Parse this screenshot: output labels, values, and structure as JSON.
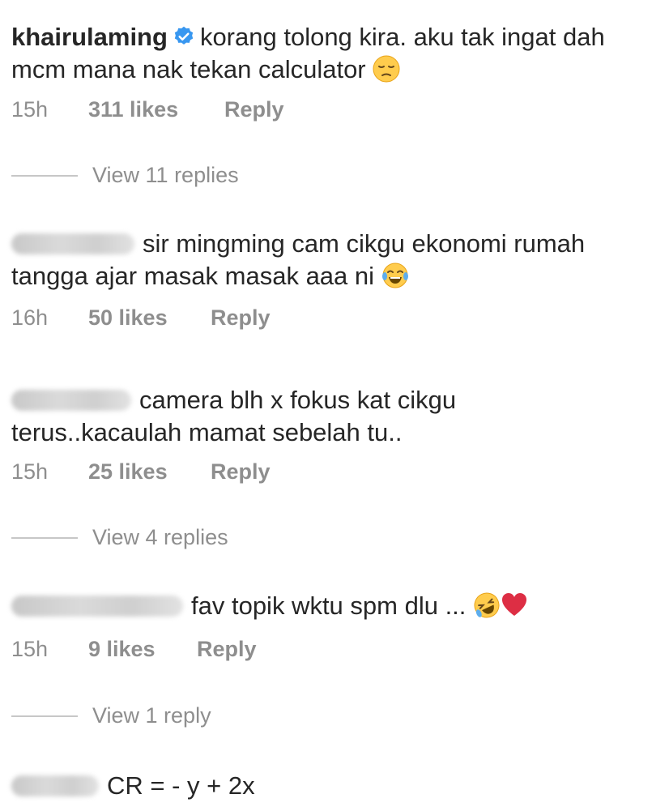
{
  "comments": [
    {
      "username": "khairulaming",
      "verified": true,
      "text_line1": "korang tolong kira. aku tak ingat dah",
      "text_line2": "mcm mana nak tekan calculator",
      "emoji": "pensive-face-icon",
      "time": "15h",
      "likes": "311 likes",
      "reply": "Reply",
      "view_replies": "View 11 replies"
    },
    {
      "username": "",
      "text_line1": "sir mingming cam cikgu ekonomi rumah",
      "text_line2": "tangga ajar masak masak aaa ni",
      "emoji": "tears-of-joy-icon",
      "time": "16h",
      "likes": "50 likes",
      "reply": "Reply"
    },
    {
      "username": "",
      "text_line1": "camera blh x fokus kat cikgu",
      "text_line2": "terus..kacaulah mamat sebelah tu..",
      "time": "15h",
      "likes": "25 likes",
      "reply": "Reply",
      "view_replies": "View 4 replies"
    },
    {
      "username": "",
      "text_line1": "fav topik wktu spm dlu ...",
      "emoji": "rolling-laughing-icon",
      "emoji2": "red-heart-icon",
      "time": "15h",
      "likes": "9 likes",
      "reply": "Reply",
      "view_replies": "View 1 reply"
    },
    {
      "username": "",
      "text_line1": "CR = - y + 2x"
    }
  ],
  "colors": {
    "text": "#262626",
    "meta": "#8e8e8e",
    "verified": "#3897f0",
    "heart": "#e0245e"
  }
}
